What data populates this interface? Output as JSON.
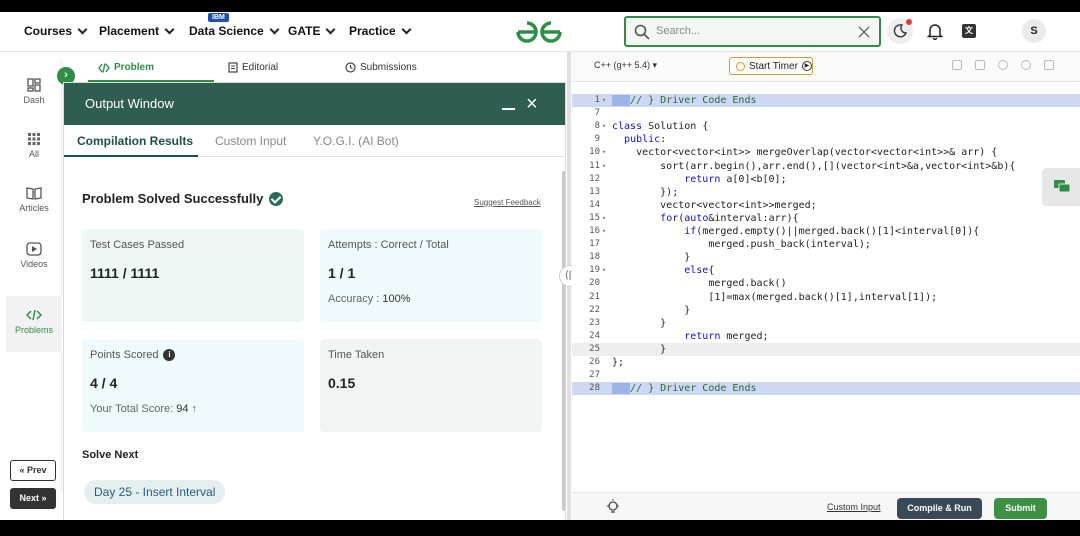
{
  "nav": {
    "items": [
      "Courses",
      "Placement",
      "Data Science",
      "GATE",
      "Practice"
    ],
    "ibm_badge": "IBM",
    "search_placeholder": "Search...",
    "translate_glyph": "文",
    "avatar_letter": "S"
  },
  "rail": {
    "items": [
      "Dash",
      "All",
      "Articles",
      "Videos",
      "Problems"
    ],
    "prev": "« Prev",
    "next": "Next »"
  },
  "problem_tabs": [
    "Problem",
    "Editorial",
    "Submissions"
  ],
  "output": {
    "title": "Output Window",
    "tabs": [
      "Compilation Results",
      "Custom Input",
      "Y.O.G.I. (AI Bot)"
    ],
    "status": "Problem Solved Successfully",
    "feedback": "Suggest Feedback",
    "test_cases_label": "Test Cases Passed",
    "test_cases_value": "1111 / 1111",
    "attempts_label": "Attempts : Correct / Total",
    "attempts_value": "1 / 1",
    "accuracy_label": "Accuracy :",
    "accuracy_value": "100%",
    "points_label": "Points Scored",
    "points_value": "4 / 4",
    "total_score_label": "Your Total Score:",
    "total_score_value": "94",
    "time_label": "Time Taken",
    "time_value": "0.15",
    "solve_next": "Solve Next",
    "next_problem": "Day 25 - Insert Interval"
  },
  "editor": {
    "language": "C++ (g++ 5.4)",
    "timer": "Start Timer",
    "lines": [
      {
        "n": "1",
        "fold": true,
        "hl": true,
        "text": "// } Driver Code Ends"
      },
      {
        "n": "7",
        "text": ""
      },
      {
        "n": "8",
        "fold": true,
        "text": "class Solution {"
      },
      {
        "n": "9",
        "text": "  public:"
      },
      {
        "n": "10",
        "fold": true,
        "text": "    vector<vector<int>> mergeOverlap(vector<vector<int>>& arr) {"
      },
      {
        "n": "11",
        "fold": true,
        "text": "        sort(arr.begin(),arr.end(),[](vector<int>&a,vector<int>&b){"
      },
      {
        "n": "12",
        "text": "            return a[0]<b[0];"
      },
      {
        "n": "13",
        "text": "        });"
      },
      {
        "n": "14",
        "text": "        vector<vector<int>>merged;"
      },
      {
        "n": "15",
        "fold": true,
        "text": "        for(auto&interval:arr){"
      },
      {
        "n": "16",
        "fold": true,
        "text": "            if(merged.empty()||merged.back()[1]<interval[0]){"
      },
      {
        "n": "17",
        "text": "                merged.push_back(interval);"
      },
      {
        "n": "18",
        "text": "            }"
      },
      {
        "n": "19",
        "fold": true,
        "text": "            else{"
      },
      {
        "n": "20",
        "text": "                merged.back()"
      },
      {
        "n": "21",
        "text": "                [1]=max(merged.back()[1],interval[1]);"
      },
      {
        "n": "22",
        "text": "            }"
      },
      {
        "n": "23",
        "text": "        }"
      },
      {
        "n": "24",
        "text": "            return merged;"
      },
      {
        "n": "25",
        "cur": true,
        "text": "        }"
      },
      {
        "n": "26",
        "text": "};"
      },
      {
        "n": "27",
        "text": ""
      },
      {
        "n": "28",
        "hl": true,
        "text": "// } Driver Code Ends"
      }
    ],
    "custom_input": "Custom Input",
    "compile_run": "Compile & Run",
    "submit": "Submit"
  }
}
